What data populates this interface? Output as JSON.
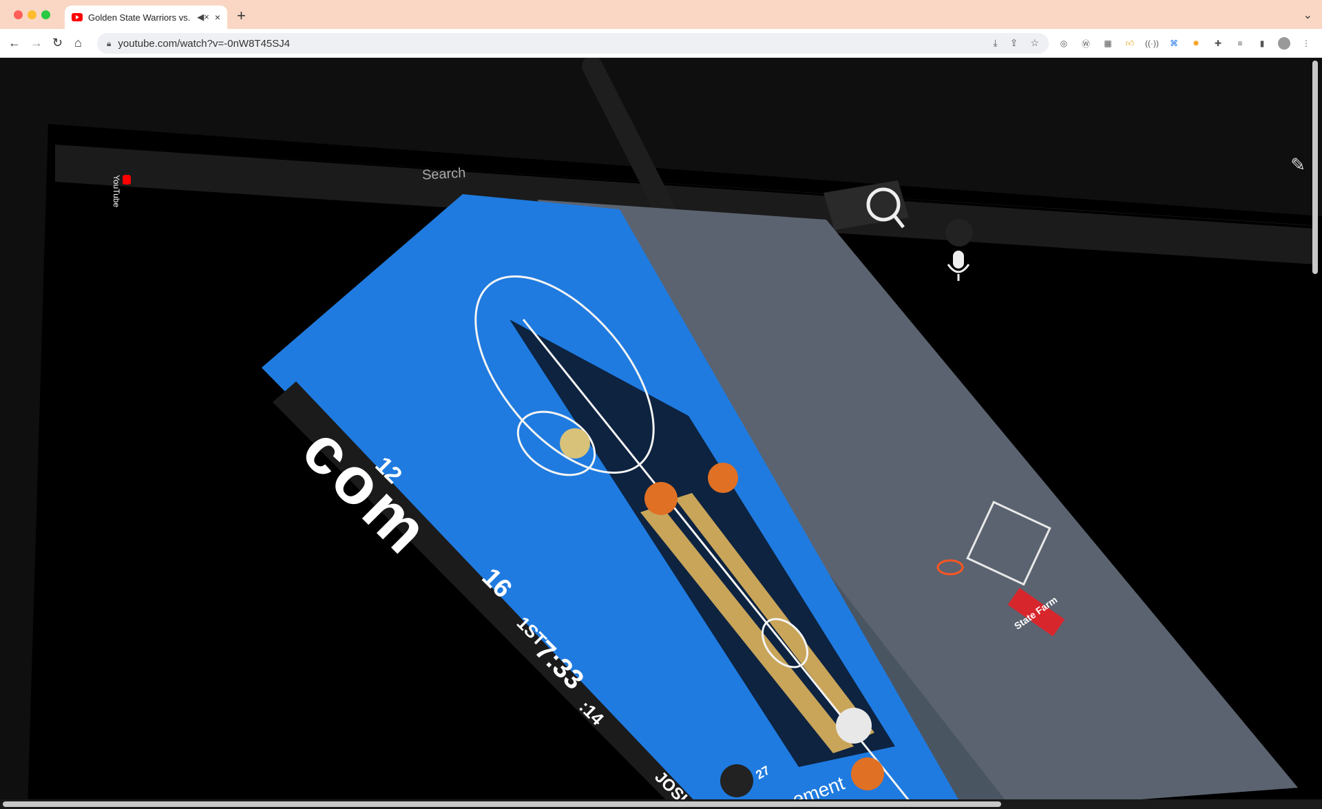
{
  "browser": {
    "tab_title": "Golden State Warriors vs.",
    "tab_mute_icon": "speaker-muted-icon",
    "tab_close_label": "×",
    "new_tab_label": "+",
    "url": "youtube.com/watch?v=-0nW8T45SJ4",
    "extensions": [
      "download-icon",
      "share-icon",
      "star-icon",
      "profile-icon",
      "wordpress-icon",
      "calc-icon",
      "thumbs-up-icon",
      "broadcast-icon",
      "translate-icon",
      "sun-icon",
      "puzzle-icon",
      "playlist-icon",
      "sidebar-icon",
      "avatar-icon",
      "more-icon"
    ]
  },
  "youtube": {
    "logo_text": "YouTube",
    "search_placeholder": "Search"
  },
  "video": {
    "score_away": "12",
    "score_home": "16",
    "quarter": "1ST",
    "clock": "7:33",
    "shot_clock": ":14",
    "court_text": "com",
    "sponsor": "State Farm",
    "bottom_text": "ement",
    "player_name": "JOSH",
    "referee_number": "27"
  },
  "colors": {
    "page_bg": "#0f0f0f",
    "court_blue": "#1f7be0",
    "key_navy": "#0d2340",
    "stripe_gold": "#c9a55a",
    "chrome_titlebar": "#f9d7c4"
  }
}
